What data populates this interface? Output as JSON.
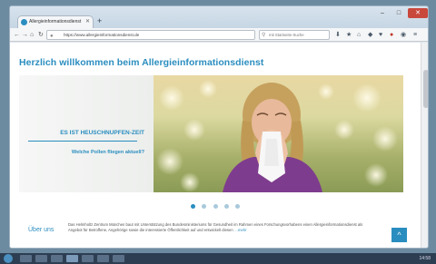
{
  "browser": {
    "tab_title": "Allergieinformationsdienst",
    "new_tab": "+",
    "url": "https://www.allergieinformationsdienst.de",
    "search_placeholder": "mit Startseite-Suche",
    "window_controls": {
      "minimize": "–",
      "maximize": "□",
      "close": "✕"
    },
    "nav": {
      "back": "←",
      "forward": "→",
      "home": "⌂",
      "reload": "↻"
    },
    "toolbar_icons": [
      "download-icon",
      "bookmark-icon",
      "home-icon",
      "shield-icon",
      "heart-icon",
      "addon-icon",
      "menu-icon"
    ]
  },
  "page": {
    "heading": "Herzlich willkommen beim Allergieinformationsdienst",
    "slide": {
      "headline": "ES IST HEUSCHNUPFEN-ZEIT",
      "subline": "Welche Pollen fliegen aktuell?"
    },
    "carousel": {
      "count": 5,
      "active": 0
    },
    "about": {
      "title": "Über uns",
      "text": "Das Helmholtz Zentrum München baut mit Unterstützung des Bundesministeriums für Gesundheit im Rahmen eines Forschungsvorhabens einen Allergieinformationsdienst als Angebot für Betroffene, Angehörige sowie die interessierte Öffentlichkeit auf und entwickelt diesen",
      "more": "…mehr"
    },
    "to_top": "^"
  },
  "taskbar": {
    "clock": "14:58"
  },
  "colors": {
    "accent": "#2a8dbf",
    "text": "#555555"
  }
}
